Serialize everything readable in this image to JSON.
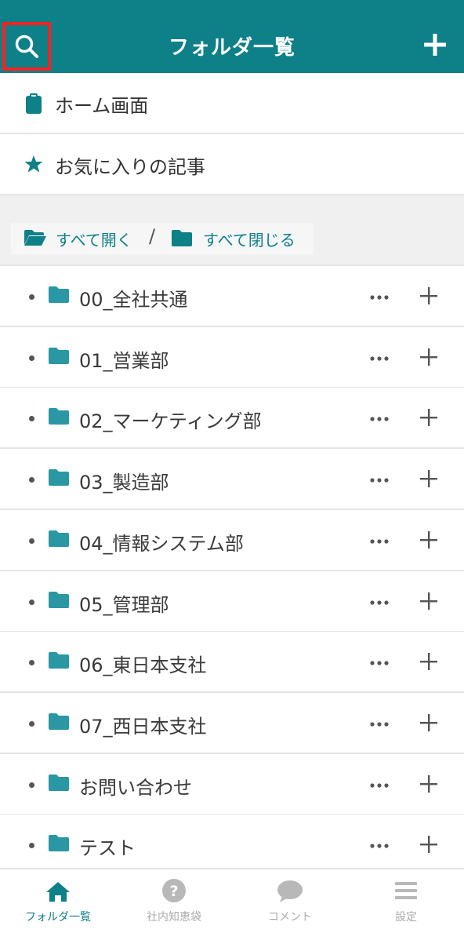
{
  "header": {
    "title": "フォルダ一覧"
  },
  "nav": [
    {
      "label": "ホーム画面",
      "icon": "clipboard-icon"
    },
    {
      "label": "お気に入りの記事",
      "icon": "star-icon"
    }
  ],
  "toggles": {
    "expand_all": "すべて開く",
    "separator": "/",
    "collapse_all": "すべて閉じる"
  },
  "folders": [
    "00_全社共通",
    "01_営業部",
    "02_マーケティング部",
    "03_製造部",
    "04_情報システム部",
    "05_管理部",
    "06_東日本支社",
    "07_西日本支社",
    "お問い合わせ",
    "テスト"
  ],
  "tabs": [
    {
      "label": "フォルダ一覧",
      "icon": "home-icon",
      "active": true
    },
    {
      "label": "社内知恵袋",
      "icon": "question-icon",
      "active": false
    },
    {
      "label": "コメント",
      "icon": "comment-icon",
      "active": false
    },
    {
      "label": "設定",
      "icon": "menu-icon",
      "active": false
    }
  ],
  "colors": {
    "accent": "#0d8088",
    "highlight_border": "#ff2020",
    "inactive": "#aaaaaa"
  }
}
